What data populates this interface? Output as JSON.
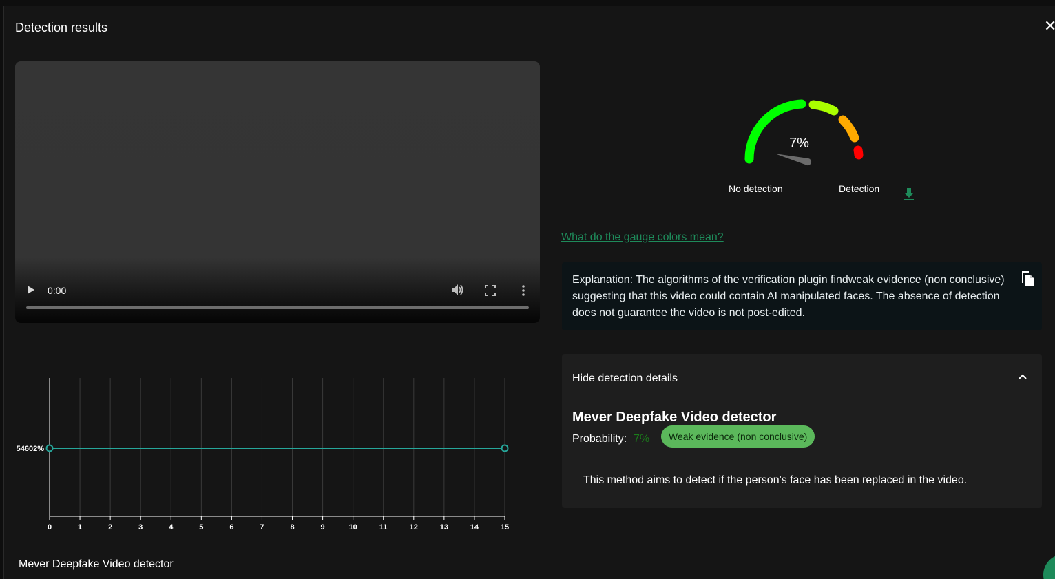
{
  "dialog": {
    "title": "Detection results",
    "close_icon": "close-icon"
  },
  "video": {
    "time": "0:00",
    "icons": [
      "play-icon",
      "volume-icon",
      "fullscreen-icon",
      "more-options-icon"
    ]
  },
  "gauge": {
    "value_text": "7%",
    "value": 7,
    "label_no_detection": "No detection",
    "label_detection": "Detection",
    "segment_colors": [
      "#00ff00",
      "#aaff00",
      "#ffaa00",
      "#ff0000"
    ],
    "needle_color": "#6b6b6b",
    "download_icon": "download-icon"
  },
  "gauge_link": "What do the gauge colors mean?",
  "explanation": {
    "text": "Explanation: The algorithms of the verification plugin findweak evidence (non conclusive) suggesting that this video could contain AI manipulated faces. The absence of detection does not guarantee the video is not post-edited.",
    "copy_icon": "copy-icon"
  },
  "details": {
    "header": "Hide detection details",
    "chevron_icon": "chevron-up-icon",
    "detector_title": "Mever Deepfake Video detector",
    "probability_label": "Probability:",
    "probability_value": "7%",
    "evidence_badge": "Weak evidence (non conclusive)",
    "method_description": "This method aims to detect if the person's face has been replaced in the video."
  },
  "chart_data": {
    "type": "line",
    "x": [
      0,
      15
    ],
    "y": [
      7,
      7
    ],
    "xticks": [
      "0",
      "1",
      "2",
      "3",
      "4",
      "5",
      "6",
      "7",
      "8",
      "9",
      "10",
      "11",
      "12",
      "13",
      "14",
      "15"
    ],
    "y_tick_label": "54602%",
    "xlim": [
      0,
      15
    ],
    "line_color": "#26a69a",
    "grid": true,
    "caption": "Mever Deepfake Video detector"
  },
  "accent_color": "#1e8a5a"
}
